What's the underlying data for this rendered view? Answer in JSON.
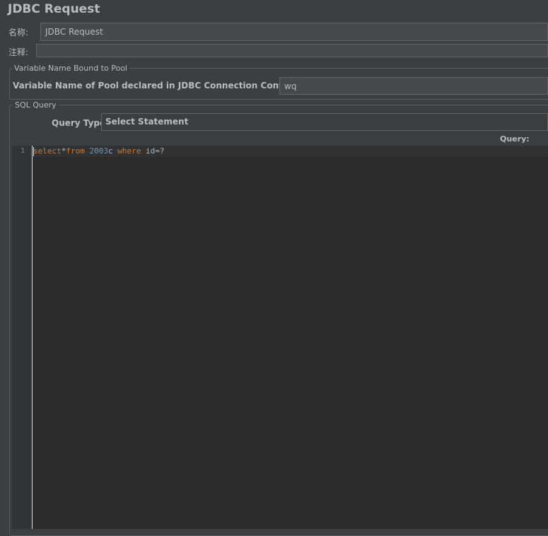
{
  "header": {
    "title": "JDBC Request"
  },
  "name_row": {
    "label": "名称:",
    "value": "JDBC Request"
  },
  "comment_row": {
    "label": "注释:",
    "value": ""
  },
  "pool_section": {
    "legend": "Variable Name Bound to Pool",
    "field_label": "Variable Name of Pool declared in JDBC Connection Configuration:",
    "field_value": "wq"
  },
  "sql_section": {
    "legend": "SQL Query",
    "query_type_label": "Query Type:",
    "query_type_value": "Select Statement",
    "query_label": "Query:"
  },
  "editor": {
    "line_numbers": [
      "1"
    ],
    "tokens": [
      {
        "text": "select",
        "kind": "keyword"
      },
      {
        "text": "*",
        "kind": "plain"
      },
      {
        "text": "from",
        "kind": "keyword"
      },
      {
        "text": " ",
        "kind": "plain"
      },
      {
        "text": "2003",
        "kind": "number"
      },
      {
        "text": "c ",
        "kind": "plain"
      },
      {
        "text": "where",
        "kind": "keyword"
      },
      {
        "text": " id=?",
        "kind": "plain"
      }
    ]
  },
  "colors": {
    "background": "#3c3f41",
    "editor_background": "#2b2b2b",
    "keyword": "#cc7832",
    "number": "#6897bb",
    "text": "#a9b7c6"
  }
}
